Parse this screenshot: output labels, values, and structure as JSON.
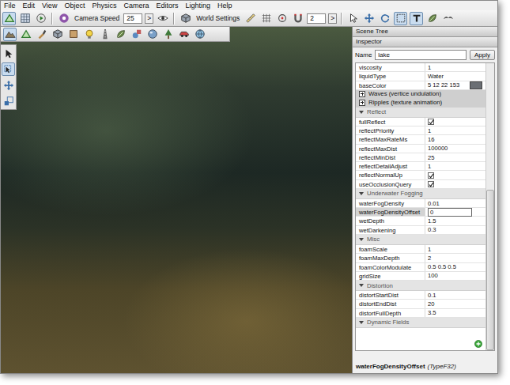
{
  "menu": [
    "File",
    "Edit",
    "View",
    "Object",
    "Physics",
    "Camera",
    "Editors",
    "Lighting",
    "Help"
  ],
  "toolbar": {
    "camera_speed_label": "Camera Speed",
    "camera_speed": "25",
    "camera_speed_arrow": ">",
    "world_settings": "World Settings",
    "snap_value": "2",
    "snap_arrow": ">",
    "buttons": [
      {
        "selected": true
      },
      {
        "selected": false
      },
      {
        "selected": false
      },
      {
        "selected": false
      },
      {
        "selected": false
      },
      {
        "selected": false
      },
      {
        "selected": false
      },
      {
        "selected": false
      },
      {
        "selected": false
      },
      {
        "selected": false
      },
      {
        "selected": false
      },
      {
        "selected": false
      },
      {
        "selected": false
      },
      {
        "selected": true
      },
      {
        "selected": true
      },
      {
        "selected": false
      },
      {
        "selected": false
      }
    ]
  },
  "mode_buttons": [
    {
      "selected": true
    },
    {
      "selected": false
    },
    {
      "selected": false
    },
    {
      "selected": false
    },
    {
      "selected": false
    },
    {
      "selected": false
    },
    {
      "selected": false
    },
    {
      "selected": false
    },
    {
      "selected": false
    },
    {
      "selected": false
    },
    {
      "selected": false
    },
    {
      "selected": false
    },
    {
      "selected": false
    }
  ],
  "palette": [
    {
      "selected": false
    },
    {
      "selected": true
    },
    {
      "selected": false
    },
    {
      "selected": false
    }
  ],
  "panel": {
    "scene_tree": "Scene Tree",
    "inspector": "Inspector",
    "name_label": "Name",
    "name_value": "lake",
    "apply": "Apply"
  },
  "inspector": {
    "rows": [
      {
        "kind": "text",
        "label": "viscosity",
        "value": "1",
        "selected": false
      },
      {
        "kind": "text",
        "label": "liquidType",
        "value": "Water",
        "selected": false
      },
      {
        "kind": "color",
        "label": "baseColor",
        "value": "5 12 22 153",
        "color": "#6b6f74",
        "selected": false
      }
    ],
    "sections": [
      {
        "title": "Waves (vertice undulation)",
        "expanded": false,
        "rows": []
      },
      {
        "title": "Ripples (texture animation)",
        "expanded": false,
        "rows": []
      },
      {
        "title": "Reflect",
        "expanded": true,
        "rows": [
          {
            "kind": "check",
            "label": "fullReflect",
            "checked": true,
            "selected": false
          },
          {
            "kind": "text",
            "label": "reflectPriority",
            "value": "1",
            "selected": false
          },
          {
            "kind": "text",
            "label": "reflectMaxRateMs",
            "value": "16",
            "selected": false
          },
          {
            "kind": "text",
            "label": "reflectMaxDist",
            "value": "100000",
            "selected": false
          },
          {
            "kind": "text",
            "label": "reflectMinDist",
            "value": "25",
            "selected": false
          },
          {
            "kind": "text",
            "label": "reflectDetailAdjust",
            "value": "1",
            "selected": false
          },
          {
            "kind": "check",
            "label": "reflectNormalUp",
            "checked": true,
            "selected": false
          },
          {
            "kind": "check",
            "label": "useOcclusionQuery",
            "checked": true,
            "selected": false
          }
        ]
      },
      {
        "title": "Underwater Fogging",
        "expanded": true,
        "rows": [
          {
            "kind": "text",
            "label": "waterFogDensity",
            "value": "0.01",
            "selected": false
          },
          {
            "kind": "edit",
            "label": "waterFogDensityOffset",
            "value": "0",
            "selected": true
          },
          {
            "kind": "text",
            "label": "wetDepth",
            "value": "1.5",
            "selected": false
          },
          {
            "kind": "text",
            "label": "wetDarkening",
            "value": "0.3",
            "selected": false
          }
        ]
      },
      {
        "title": "Misc",
        "expanded": true,
        "rows": [
          {
            "kind": "text",
            "label": "foamScale",
            "value": "1",
            "selected": false
          },
          {
            "kind": "text",
            "label": "foamMaxDepth",
            "value": "2",
            "selected": false
          },
          {
            "kind": "text",
            "label": "foamColorModulate",
            "value": "0.5 0.5 0.5",
            "selected": false
          },
          {
            "kind": "text",
            "label": "gridSize",
            "value": "100",
            "selected": false
          }
        ]
      },
      {
        "title": "Distortion",
        "expanded": true,
        "rows": [
          {
            "kind": "text",
            "label": "distortStartDist",
            "value": "0.1",
            "selected": false
          },
          {
            "kind": "text",
            "label": "distortEndDist",
            "value": "20",
            "selected": false
          },
          {
            "kind": "text",
            "label": "distortFullDepth",
            "value": "3.5",
            "selected": false
          }
        ]
      },
      {
        "title": "Dynamic Fields",
        "expanded": true,
        "rows": []
      }
    ],
    "scrollbar": {
      "level": 0.56
    }
  },
  "status": {
    "field": "waterFogDensityOffset",
    "type": "(TypeF32)"
  }
}
